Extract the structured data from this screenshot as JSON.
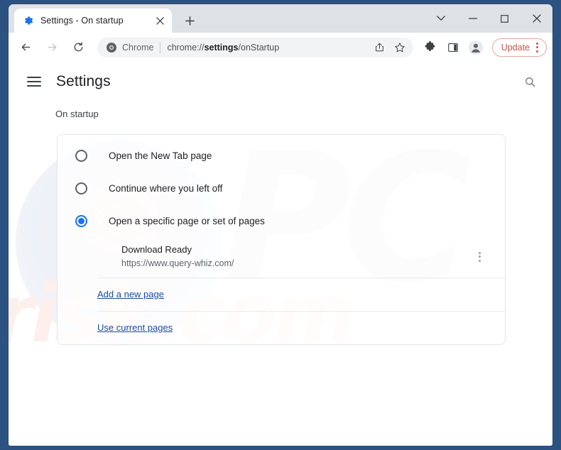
{
  "browser": {
    "tab": {
      "title": "Settings - On startup",
      "favicon_icon": "gear-icon",
      "close_icon": "close-icon"
    },
    "new_tab_icon": "plus-icon",
    "window_controls": [
      {
        "name": "tab-search",
        "icon": "chevron-down-icon"
      },
      {
        "name": "minimize",
        "icon": "minimize-icon"
      },
      {
        "name": "maximize",
        "icon": "maximize-icon"
      },
      {
        "name": "close",
        "icon": "close-icon"
      }
    ],
    "toolbar": {
      "back_icon": "arrow-left-icon",
      "forward_icon": "arrow-right-icon",
      "reload_icon": "reload-icon",
      "omnibox": {
        "chrome_icon": "chrome-icon",
        "chrome_label": "Chrome",
        "url_prefix": "chrome://",
        "url_bold": "settings",
        "url_suffix": "/onStartup",
        "share_icon": "share-icon",
        "bookmark_icon": "star-icon"
      },
      "extensions_icon": "puzzle-icon",
      "side_panel_icon": "side-panel-icon",
      "profile_icon": "avatar-icon",
      "update_label": "Update",
      "update_menu_icon": "kebab-icon",
      "update_border_color": "#e0a9a2",
      "update_text_color": "#c5544a"
    }
  },
  "settings": {
    "menu_icon": "hamburger-icon",
    "title": "Settings",
    "search_icon": "search-icon",
    "section_label": "On startup",
    "options": [
      {
        "label": "Open the New Tab page",
        "checked": false
      },
      {
        "label": "Continue where you left off",
        "checked": false
      },
      {
        "label": "Open a specific page or set of pages",
        "checked": true
      }
    ],
    "startup_pages": [
      {
        "title": "Download Ready",
        "url": "https://www.query-whiz.com/",
        "menu_icon": "kebab-icon"
      }
    ],
    "links": [
      {
        "label": "Add a new page"
      },
      {
        "label": "Use current pages"
      }
    ],
    "accent_color": "#1a73e8",
    "link_color": "#1a4b9c"
  },
  "watermarks": {
    "primary": "PC",
    "secondary": "risk.com"
  }
}
